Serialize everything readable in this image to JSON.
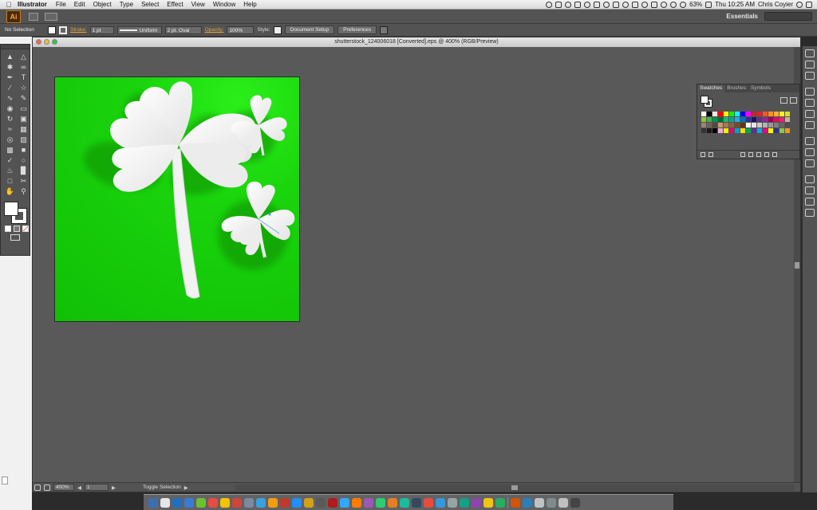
{
  "menubar": {
    "app_name": "Illustrator",
    "items": [
      "File",
      "Edit",
      "Object",
      "Type",
      "Select",
      "Effect",
      "View",
      "Window",
      "Help"
    ],
    "battery": "63%",
    "clock": "Thu 10:25 AM",
    "user": "Chris Coyier"
  },
  "appbar": {
    "logo": "Ai",
    "workspace": "Essentials"
  },
  "control_bar": {
    "selection": "No Selection",
    "stroke_label": "Stroke:",
    "stroke_weight": "1 pt",
    "profile": "Uniform",
    "brush": "2 pt. Oval",
    "opacity_label": "Opacity:",
    "opacity_value": "100%",
    "style_label": "Style:",
    "document_setup": "Document Setup",
    "preferences": "Preferences"
  },
  "document": {
    "title": "shutterstock_124006018 [Converted].eps @ 400% (RGB/Preview)",
    "zoom": "400%",
    "artboard_number": "1",
    "status": "Toggle Selection",
    "vscroll_position": 0.5,
    "hscroll_position": 0.5
  },
  "swatches_panel": {
    "tabs": [
      "Swatches",
      "Brushes",
      "Symbols"
    ],
    "active_tab": "Swatches",
    "colors": [
      "#ffffff",
      "#000000",
      "#e8e8e8",
      "#ff0000",
      "#ffff00",
      "#00ff00",
      "#00ffff",
      "#0000ff",
      "#ff00ff",
      "#c1272d",
      "#ed1c24",
      "#f15a24",
      "#f7931e",
      "#fbb03b",
      "#fcee21",
      "#d9e021",
      "#8cc63f",
      "#39b54a",
      "#009245",
      "#006837",
      "#22b573",
      "#00a99d",
      "#29abe2",
      "#0071bc",
      "#2e3192",
      "#1b1464",
      "#662d91",
      "#93278f",
      "#9e005d",
      "#d4145a",
      "#ed1e79",
      "#c7b299",
      "#998675",
      "#736357",
      "#534741",
      "#c69c6d",
      "#a67c52",
      "#8c6239",
      "#754c24",
      "#603813",
      "#ffffff",
      "#e6e6e6",
      "#cccccc",
      "#b3b3b3",
      "#999999",
      "#808080",
      "#666666",
      "#4d4d4d",
      "#333333",
      "#1a1a1a",
      "#000000",
      "#f2a7d4",
      "#ffed00",
      "#e6007e",
      "#009ee0",
      "#ffde00",
      "#00a651",
      "#662d91",
      "#00aeef",
      "#ec008c",
      "#fff200",
      "#2e3192",
      "#8dc63f",
      "#f7941d"
    ]
  },
  "dock": {
    "colors": [
      "#3b6fb5",
      "#e6e6e6",
      "#1f70c1",
      "#3a7bd5",
      "#6cbf2f",
      "#e84c3d",
      "#f5c400",
      "#d0453a",
      "#7a8aa0",
      "#3aa0e0",
      "#f39c12",
      "#c0392b",
      "#1e90ff",
      "#d4a017",
      "#5a5a5a",
      "#b01b1b",
      "#31a8ff",
      "#ff7c00",
      "#9b59b6",
      "#2ecc71",
      "#e67e22",
      "#1abc9c",
      "#34495e",
      "#e74c3c",
      "#3498db",
      "#95a5a6",
      "#16a085",
      "#8e44ad",
      "#f1c40f",
      "#27ae60",
      "#d35400",
      "#2980b9",
      "#bdc3c7",
      "#7f8c8d",
      "#c0c0c0",
      "#444444"
    ]
  }
}
